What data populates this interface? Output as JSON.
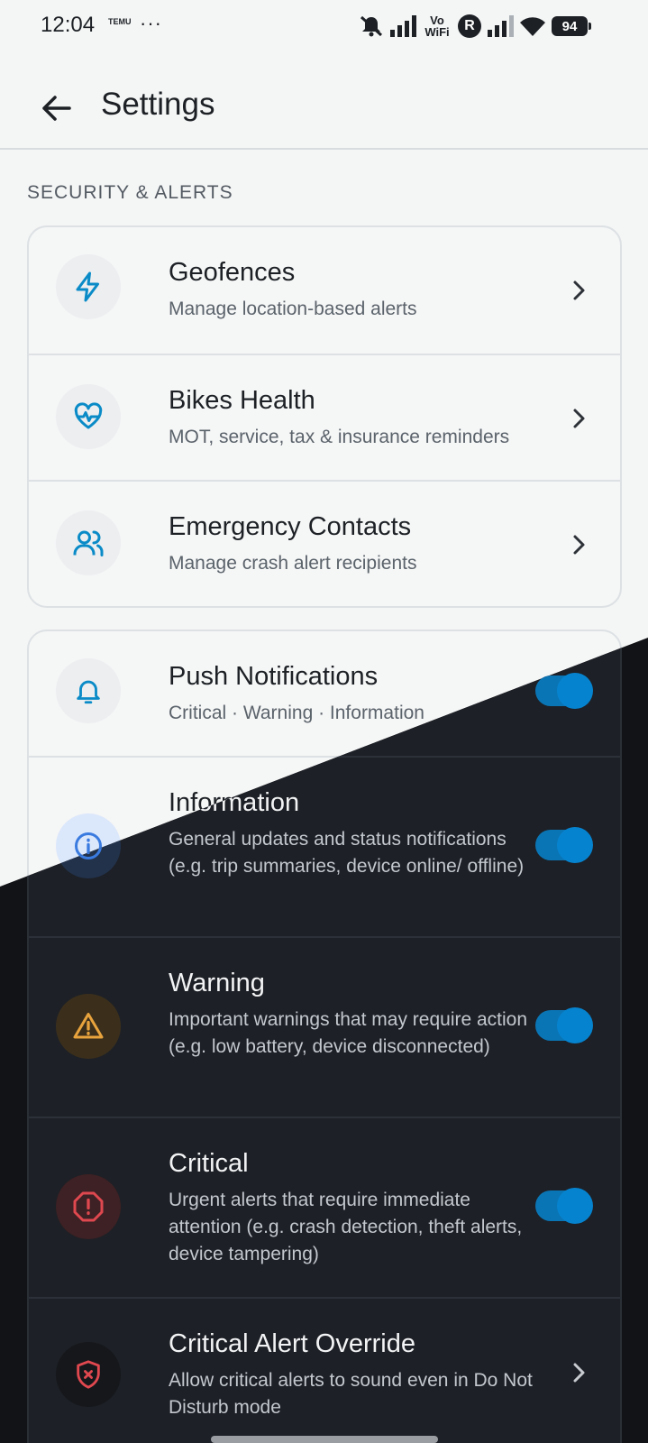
{
  "status_bar": {
    "time": "12:04",
    "carrier_badge": "TEMU",
    "more": "···",
    "volte": "Vo WiFi",
    "roaming": "R",
    "battery": "94"
  },
  "app_bar": {
    "title": "Settings"
  },
  "section": {
    "label": "SECURITY & ALERTS"
  },
  "security_items": [
    {
      "title": "Geofences",
      "subtitle": "Manage location-based alerts",
      "icon": "lightning-icon"
    },
    {
      "title": "Bikes Health",
      "subtitle": "MOT, service, tax & insurance reminders",
      "icon": "heart-pulse-icon"
    },
    {
      "title": "Emergency Contacts",
      "subtitle": "Manage crash alert recipients",
      "icon": "users-icon"
    }
  ],
  "notifications": {
    "push": {
      "title": "Push Notifications",
      "subtitle": "Critical · Warning · Information",
      "enabled": true
    },
    "information": {
      "title": "Information",
      "subtitle": "General updates and status notifications (e.g. trip summaries, device online/ offline)",
      "enabled": true
    },
    "warning": {
      "title": "Warning",
      "subtitle": "Important warnings that may require action (e.g. low battery, device disconnected)",
      "enabled": true
    },
    "critical": {
      "title": "Critical",
      "subtitle": "Urgent alerts that require immediate attention (e.g. crash detection, theft alerts, device tampering)",
      "enabled": true
    },
    "override": {
      "title": "Critical Alert Override",
      "subtitle": "Allow critical alerts to sound even in Do Not Disturb mode"
    }
  },
  "colors": {
    "accent": "#0a8bc7",
    "toggle_on": "#0683cf",
    "info": "#3a7be0",
    "warning": "#e8a33d",
    "critical": "#e0484f",
    "light_bg": "#f4f5f5",
    "dark_bg": "#111316"
  }
}
